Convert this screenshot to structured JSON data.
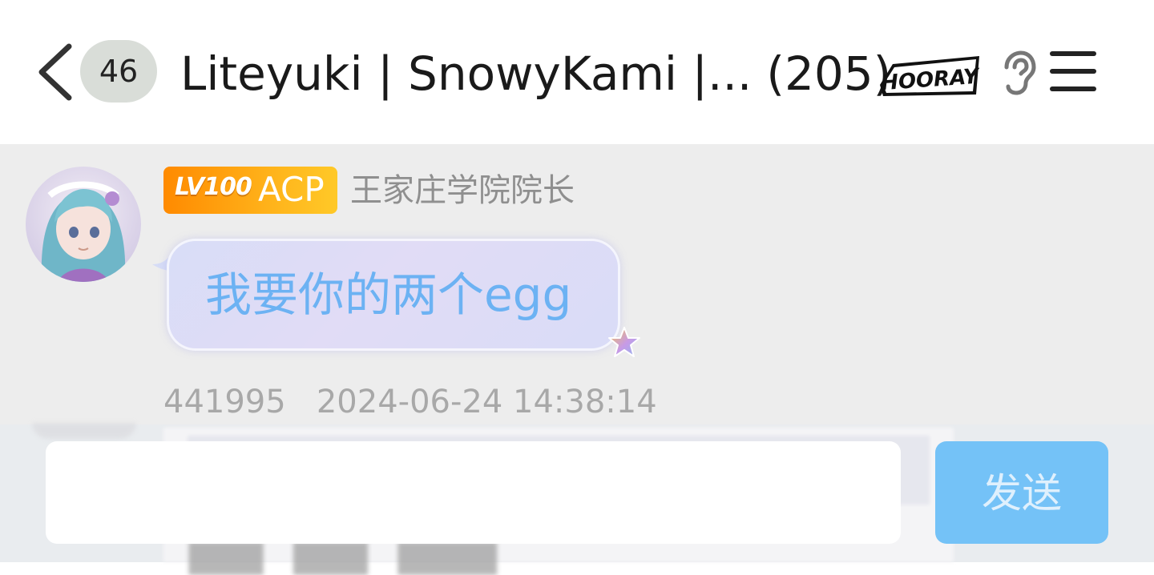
{
  "header": {
    "unread_count": "46",
    "group_name": "Liteyuki | SnowyKami |...",
    "member_count": "(205)",
    "badge_text": "HOORAY",
    "icons": [
      "chevron-left-icon",
      "ear-icon",
      "menu-icon"
    ]
  },
  "message": {
    "level_label": "LV100",
    "role_label": "ACP",
    "sender_title": "王家庄学院院长",
    "text": "我要你的两个egg",
    "sender_id": "441995",
    "timestamp": "2024-06-24 14:38:14"
  },
  "composer": {
    "input_value": "",
    "send_label": "发送"
  },
  "colors": {
    "bubble_text": "#6cb2f3",
    "level_badge": "#ff9a0d",
    "send_button": "#74c2f7",
    "chat_background": "#ededed"
  }
}
